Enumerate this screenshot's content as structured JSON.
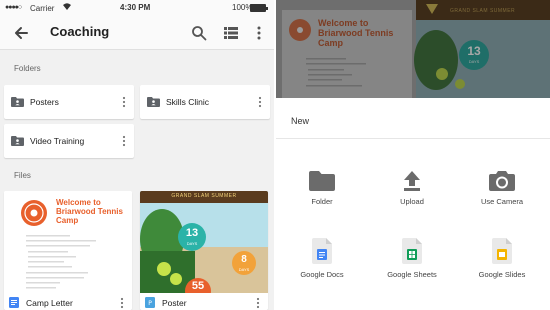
{
  "status_bar": {
    "carrier": "Carrier",
    "time": "4:30 PM",
    "battery": "100%"
  },
  "app_bar": {
    "title": "Coaching"
  },
  "folders_label": "Folders",
  "folders": [
    {
      "name": "Posters"
    },
    {
      "name": "Skills Clinic"
    },
    {
      "name": "Video Training"
    }
  ],
  "files_label": "Files",
  "files": [
    {
      "name": "Camp Letter",
      "type": "docs"
    },
    {
      "name": "Poster",
      "type": "image"
    }
  ],
  "camp_letter_preview": {
    "heading": "Welcome to Briarwood Tennis Camp"
  },
  "poster_preview": {
    "banner": "GRAND SLAM SUMMER",
    "badge_count": "13",
    "badge_unit": "DAYS",
    "badge2_count": "8",
    "badge2_unit": "DAYS",
    "badge3_count": "55"
  },
  "new_sheet": {
    "title": "New",
    "options": [
      {
        "label": "Folder",
        "icon": "folder-icon"
      },
      {
        "label": "Upload",
        "icon": "upload-icon"
      },
      {
        "label": "Use Camera",
        "icon": "camera-icon"
      },
      {
        "label": "Google Docs",
        "icon": "google-docs-icon"
      },
      {
        "label": "Google Sheets",
        "icon": "google-sheets-icon"
      },
      {
        "label": "Google Slides",
        "icon": "google-slides-icon"
      }
    ]
  },
  "colors": {
    "docs_blue": "#4285f4",
    "sheets_green": "#0f9d58",
    "slides_yellow": "#f4b400",
    "camp_orange": "#e8602c",
    "poster_teal": "#2bb3a8",
    "poster_brown": "#5a3b1e"
  }
}
